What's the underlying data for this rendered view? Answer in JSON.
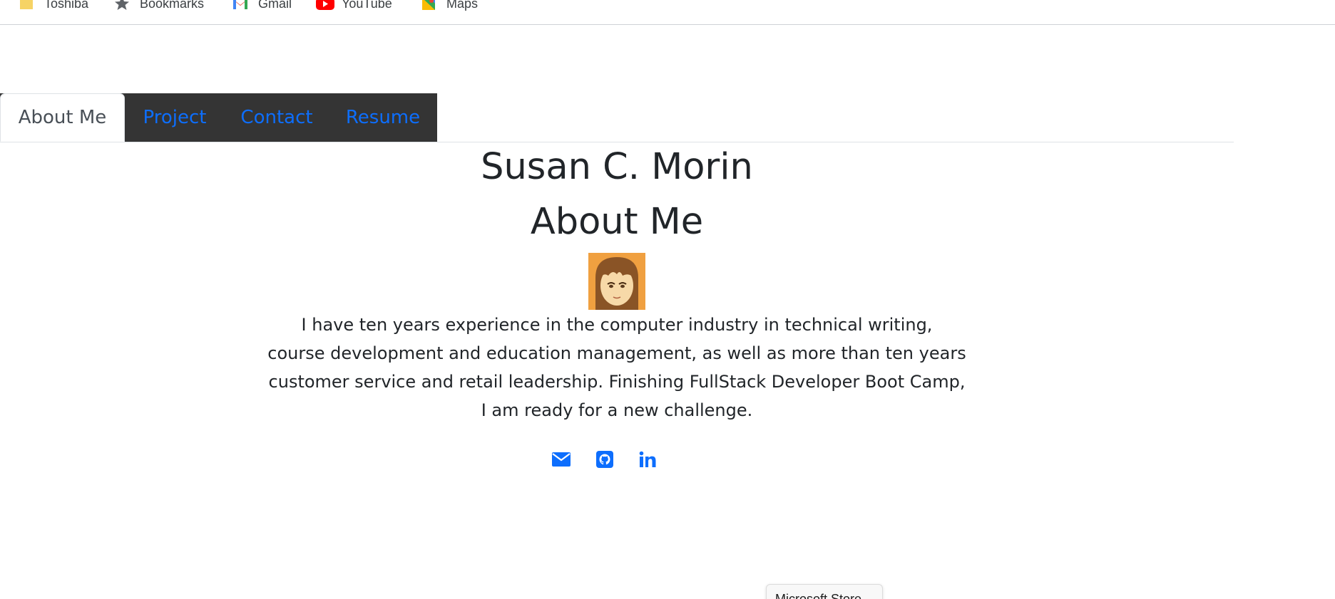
{
  "bookmarks": [
    {
      "label": "Toshiba",
      "icon": "folder-icon"
    },
    {
      "label": "Bookmarks",
      "icon": "star-icon"
    },
    {
      "label": "Gmail",
      "icon": "gmail-icon"
    },
    {
      "label": "YouTube",
      "icon": "youtube-icon"
    },
    {
      "label": "Maps",
      "icon": "maps-icon"
    }
  ],
  "tabs": [
    {
      "label": "About Me",
      "active": true
    },
    {
      "label": "Project",
      "active": false
    },
    {
      "label": "Contact",
      "active": false
    },
    {
      "label": "Resume",
      "active": false
    }
  ],
  "main": {
    "name": "Susan C. Morin",
    "section_title": "About Me",
    "bio_lines": [
      "I have ten years experience in the computer industry in technical writing,",
      "course development and education management, as well as more than ten years",
      "customer service and retail leadership. Finishing FullStack Developer Boot Camp,",
      "I am ready for a new challenge."
    ]
  },
  "social": [
    {
      "icon": "email-icon"
    },
    {
      "icon": "github-icon"
    },
    {
      "icon": "linkedin-icon"
    }
  ],
  "popup": {
    "label": "Microsoft Store"
  },
  "colors": {
    "link": "#0d6efd",
    "tab_dark": "#343434",
    "text": "#212529"
  }
}
